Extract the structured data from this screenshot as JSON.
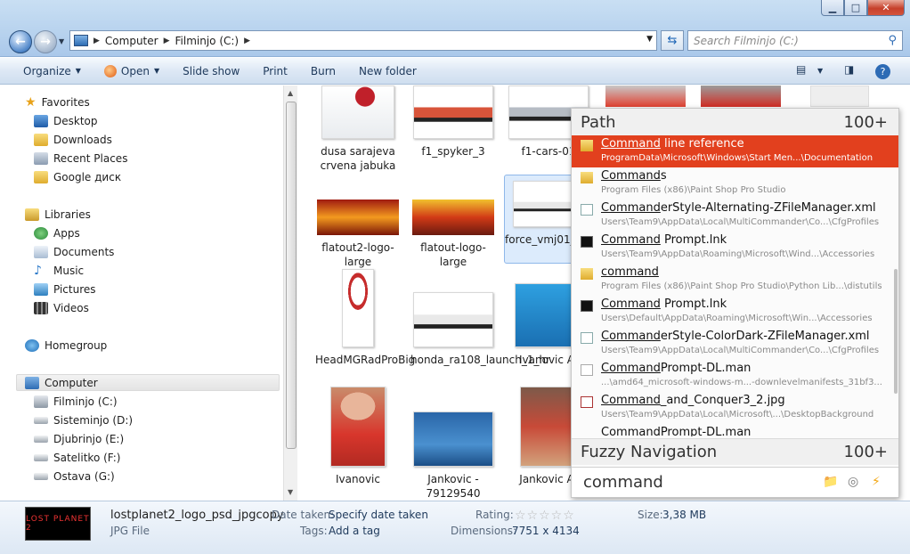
{
  "address": {
    "crumbs": [
      "Computer",
      "Filminjo (C:)"
    ]
  },
  "search": {
    "placeholder": "Search Filminjo (C:)"
  },
  "toolbar": {
    "organize": "Organize",
    "open": "Open",
    "slideshow": "Slide show",
    "print": "Print",
    "burn": "Burn",
    "new_folder": "New folder"
  },
  "nav": {
    "favorites": "Favorites",
    "fav_items": [
      "Desktop",
      "Downloads",
      "Recent Places",
      "Google диск"
    ],
    "libraries": "Libraries",
    "lib_items": [
      "Apps",
      "Documents",
      "Music",
      "Pictures",
      "Videos"
    ],
    "homegroup": "Homegroup",
    "computer": "Computer",
    "drives": [
      "Filminjo (C:)",
      "Sisteminjo (D:)",
      "Djubrinjo (E:)",
      "Satelitko (F:)",
      "Ostava (G:)"
    ]
  },
  "files": [
    {
      "label": "dusa sarajeva crvena jabuka"
    },
    {
      "label": "f1_spyker_3"
    },
    {
      "label": "f1-cars-01"
    },
    {
      "label": "flatout2-logo-large"
    },
    {
      "label": "flatout-logo-large"
    },
    {
      "label": "force_vmj01_e_111"
    },
    {
      "label": "HeadMGRadProBig"
    },
    {
      "label": "honda_ra108_launch_1_hr"
    },
    {
      "label": "Ivanovic A"
    },
    {
      "label": "Ivanovic"
    },
    {
      "label": "Jankovic - 79129540"
    },
    {
      "label": "Jankovic A"
    }
  ],
  "popup": {
    "path_header": "Path",
    "path_count": "100+",
    "results": [
      {
        "match": "Command",
        "rest": " line reference",
        "path": "ProgramData\\Microsoft\\Windows\\Start Men...\\Documentation"
      },
      {
        "match": "Command",
        "rest": "s",
        "path": "Program Files (x86)\\Paint Shop Pro Studio"
      },
      {
        "match": "Command",
        "rest": "erStyle-Alternating-ZFileManager.xml",
        "path": "Users\\Team9\\AppData\\Local\\MultiCommander\\Co...\\CfgProfiles"
      },
      {
        "match": "Command",
        "rest": " Prompt.lnk",
        "path": "Users\\Team9\\AppData\\Roaming\\Microsoft\\Wind...\\Accessories"
      },
      {
        "match": "command",
        "rest": "",
        "path": "Program Files (x86)\\Paint Shop Pro Studio\\Python Lib...\\distutils"
      },
      {
        "match": "Command",
        "rest": " Prompt.lnk",
        "path": "Users\\Default\\AppData\\Roaming\\Microsoft\\Win...\\Accessories"
      },
      {
        "match": "Command",
        "rest": "erStyle-ColorDark-ZFileManager.xml",
        "path": "Users\\Team9\\AppData\\Local\\MultiCommander\\Co...\\CfgProfiles"
      },
      {
        "match": "Command",
        "rest": "Prompt-DL.man",
        "path": "...\\amd64_microsoft-windows-m...-downlevelmanifests_31bf3..."
      },
      {
        "match": "Command",
        "rest": "_and_Conquer3_2.jpg",
        "path": "Users\\Team9\\AppData\\Local\\Microsoft\\...\\DesktopBackground"
      },
      {
        "match": "",
        "rest": "CommandPrompt-DL.man",
        "path": ""
      }
    ],
    "fuzzy_header": "Fuzzy Navigation",
    "fuzzy_count": "100+",
    "query": "command"
  },
  "details": {
    "filename": "lostplanet2_logo_psd_jpgcopy",
    "filetype": "JPG File",
    "thumb_text": "LOST PLANET 2",
    "date_label": "Date taken:",
    "date_value": "Specify date taken",
    "tags_label": "Tags:",
    "tags_value": "Add a tag",
    "rating_label": "Rating:",
    "dims_label": "Dimensions:",
    "dims_value": "7751 x 4134",
    "size_label": "Size:",
    "size_value": "3,38 MB"
  },
  "colors": {
    "highlight": "#e2401e",
    "accent": "#1e395b"
  }
}
